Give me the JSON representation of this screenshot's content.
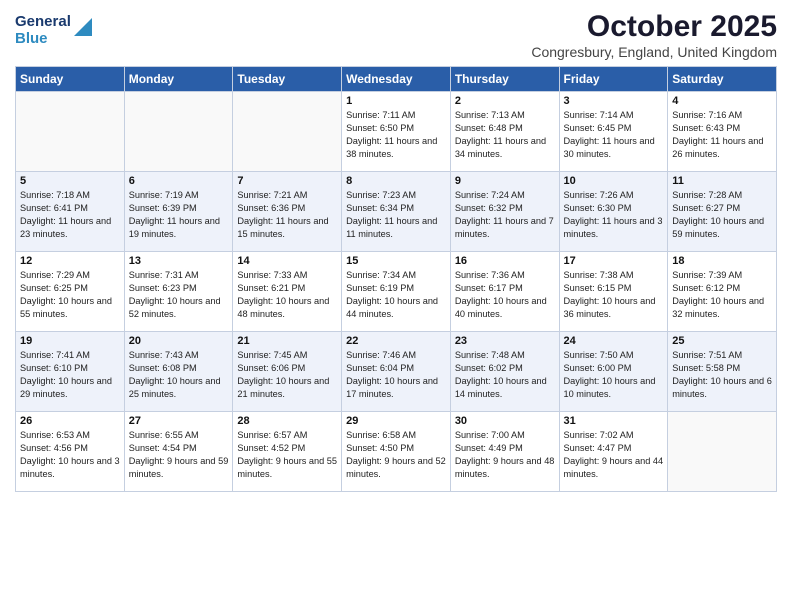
{
  "logo": {
    "general": "General",
    "blue": "Blue"
  },
  "header": {
    "month": "October 2025",
    "location": "Congresbury, England, United Kingdom"
  },
  "weekdays": [
    "Sunday",
    "Monday",
    "Tuesday",
    "Wednesday",
    "Thursday",
    "Friday",
    "Saturday"
  ],
  "weeks": [
    [
      {
        "day": "",
        "text": ""
      },
      {
        "day": "",
        "text": ""
      },
      {
        "day": "",
        "text": ""
      },
      {
        "day": "1",
        "text": "Sunrise: 7:11 AM\nSunset: 6:50 PM\nDaylight: 11 hours and 38 minutes."
      },
      {
        "day": "2",
        "text": "Sunrise: 7:13 AM\nSunset: 6:48 PM\nDaylight: 11 hours and 34 minutes."
      },
      {
        "day": "3",
        "text": "Sunrise: 7:14 AM\nSunset: 6:45 PM\nDaylight: 11 hours and 30 minutes."
      },
      {
        "day": "4",
        "text": "Sunrise: 7:16 AM\nSunset: 6:43 PM\nDaylight: 11 hours and 26 minutes."
      }
    ],
    [
      {
        "day": "5",
        "text": "Sunrise: 7:18 AM\nSunset: 6:41 PM\nDaylight: 11 hours and 23 minutes."
      },
      {
        "day": "6",
        "text": "Sunrise: 7:19 AM\nSunset: 6:39 PM\nDaylight: 11 hours and 19 minutes."
      },
      {
        "day": "7",
        "text": "Sunrise: 7:21 AM\nSunset: 6:36 PM\nDaylight: 11 hours and 15 minutes."
      },
      {
        "day": "8",
        "text": "Sunrise: 7:23 AM\nSunset: 6:34 PM\nDaylight: 11 hours and 11 minutes."
      },
      {
        "day": "9",
        "text": "Sunrise: 7:24 AM\nSunset: 6:32 PM\nDaylight: 11 hours and 7 minutes."
      },
      {
        "day": "10",
        "text": "Sunrise: 7:26 AM\nSunset: 6:30 PM\nDaylight: 11 hours and 3 minutes."
      },
      {
        "day": "11",
        "text": "Sunrise: 7:28 AM\nSunset: 6:27 PM\nDaylight: 10 hours and 59 minutes."
      }
    ],
    [
      {
        "day": "12",
        "text": "Sunrise: 7:29 AM\nSunset: 6:25 PM\nDaylight: 10 hours and 55 minutes."
      },
      {
        "day": "13",
        "text": "Sunrise: 7:31 AM\nSunset: 6:23 PM\nDaylight: 10 hours and 52 minutes."
      },
      {
        "day": "14",
        "text": "Sunrise: 7:33 AM\nSunset: 6:21 PM\nDaylight: 10 hours and 48 minutes."
      },
      {
        "day": "15",
        "text": "Sunrise: 7:34 AM\nSunset: 6:19 PM\nDaylight: 10 hours and 44 minutes."
      },
      {
        "day": "16",
        "text": "Sunrise: 7:36 AM\nSunset: 6:17 PM\nDaylight: 10 hours and 40 minutes."
      },
      {
        "day": "17",
        "text": "Sunrise: 7:38 AM\nSunset: 6:15 PM\nDaylight: 10 hours and 36 minutes."
      },
      {
        "day": "18",
        "text": "Sunrise: 7:39 AM\nSunset: 6:12 PM\nDaylight: 10 hours and 32 minutes."
      }
    ],
    [
      {
        "day": "19",
        "text": "Sunrise: 7:41 AM\nSunset: 6:10 PM\nDaylight: 10 hours and 29 minutes."
      },
      {
        "day": "20",
        "text": "Sunrise: 7:43 AM\nSunset: 6:08 PM\nDaylight: 10 hours and 25 minutes."
      },
      {
        "day": "21",
        "text": "Sunrise: 7:45 AM\nSunset: 6:06 PM\nDaylight: 10 hours and 21 minutes."
      },
      {
        "day": "22",
        "text": "Sunrise: 7:46 AM\nSunset: 6:04 PM\nDaylight: 10 hours and 17 minutes."
      },
      {
        "day": "23",
        "text": "Sunrise: 7:48 AM\nSunset: 6:02 PM\nDaylight: 10 hours and 14 minutes."
      },
      {
        "day": "24",
        "text": "Sunrise: 7:50 AM\nSunset: 6:00 PM\nDaylight: 10 hours and 10 minutes."
      },
      {
        "day": "25",
        "text": "Sunrise: 7:51 AM\nSunset: 5:58 PM\nDaylight: 10 hours and 6 minutes."
      }
    ],
    [
      {
        "day": "26",
        "text": "Sunrise: 6:53 AM\nSunset: 4:56 PM\nDaylight: 10 hours and 3 minutes."
      },
      {
        "day": "27",
        "text": "Sunrise: 6:55 AM\nSunset: 4:54 PM\nDaylight: 9 hours and 59 minutes."
      },
      {
        "day": "28",
        "text": "Sunrise: 6:57 AM\nSunset: 4:52 PM\nDaylight: 9 hours and 55 minutes."
      },
      {
        "day": "29",
        "text": "Sunrise: 6:58 AM\nSunset: 4:50 PM\nDaylight: 9 hours and 52 minutes."
      },
      {
        "day": "30",
        "text": "Sunrise: 7:00 AM\nSunset: 4:49 PM\nDaylight: 9 hours and 48 minutes."
      },
      {
        "day": "31",
        "text": "Sunrise: 7:02 AM\nSunset: 4:47 PM\nDaylight: 9 hours and 44 minutes."
      },
      {
        "day": "",
        "text": ""
      }
    ]
  ]
}
